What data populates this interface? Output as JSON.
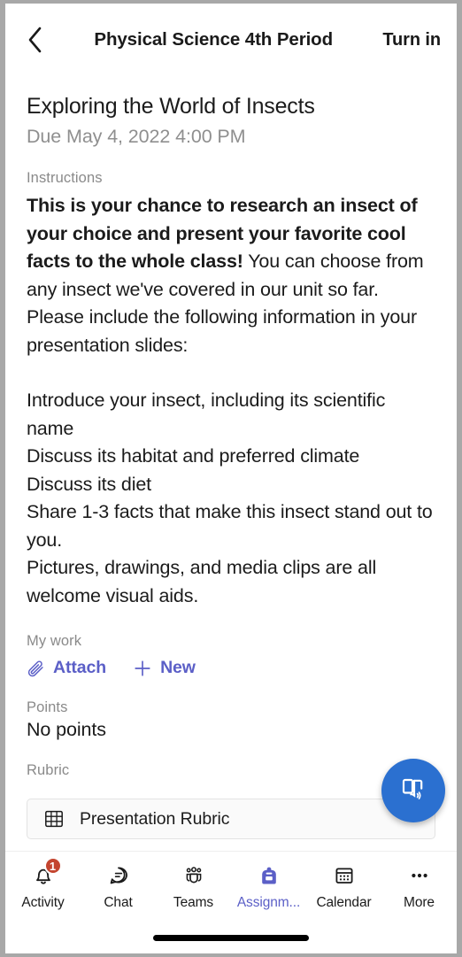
{
  "header": {
    "back_icon": "chevron-left-icon",
    "title": "Physical Science 4th Period",
    "turn_in_label": "Turn in"
  },
  "assignment": {
    "title": "Exploring the World of Insects",
    "due": "Due May 4, 2022 4:00 PM",
    "instructions_label": "Instructions",
    "instructions_bold": "This is your chance to research an insect of your choice and present your favorite cool facts to the whole class!",
    "instructions_rest": " You can choose from any insect we've covered in our unit so far. Please include the following information in your presentation slides:",
    "instructions_list": "Introduce your insect, including its scientific name\nDiscuss its habitat and preferred climate\nDiscuss its diet\nShare 1-3 facts that make this insect stand out to you.\nPictures, drawings, and media clips are all welcome visual aids."
  },
  "my_work": {
    "label": "My work",
    "attach_label": "Attach",
    "attach_icon": "paperclip-icon",
    "new_label": "New",
    "new_icon": "plus-icon"
  },
  "points": {
    "label": "Points",
    "value": "No points"
  },
  "rubric": {
    "label": "Rubric",
    "card_icon": "grid-table-icon",
    "card_name": "Presentation Rubric"
  },
  "fab": {
    "icon": "immersive-reader-icon",
    "color": "#2b70d0"
  },
  "bottom_nav": {
    "items": [
      {
        "label": "Activity",
        "icon": "bell-icon",
        "badge": "1",
        "active": false
      },
      {
        "label": "Chat",
        "icon": "chat-bubble-icon",
        "badge": "",
        "active": false
      },
      {
        "label": "Teams",
        "icon": "teams-people-icon",
        "badge": "",
        "active": false
      },
      {
        "label": "Assignm...",
        "icon": "backpack-icon",
        "badge": "",
        "active": true
      },
      {
        "label": "Calendar",
        "icon": "calendar-icon",
        "badge": "",
        "active": false
      },
      {
        "label": "More",
        "icon": "ellipsis-icon",
        "badge": "",
        "active": false
      }
    ],
    "accent_color": "#5b5fc7",
    "badge_color": "#c4452f"
  }
}
